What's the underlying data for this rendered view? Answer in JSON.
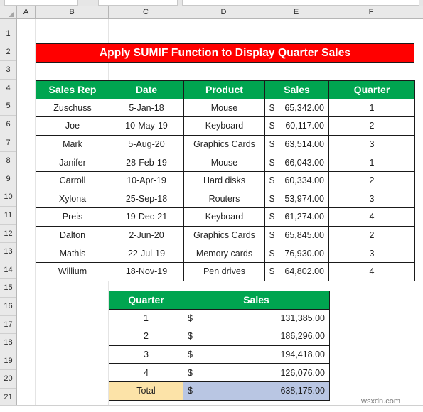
{
  "app": {
    "type": "spreadsheet",
    "watermark": "wsxdn.com"
  },
  "grid": {
    "column_headers": [
      "A",
      "B",
      "C",
      "D",
      "E",
      "F"
    ],
    "row_headers": [
      "1",
      "2",
      "3",
      "4",
      "5",
      "6",
      "7",
      "8",
      "9",
      "10",
      "11",
      "12",
      "13",
      "14",
      "15",
      "16",
      "17",
      "18",
      "19",
      "20",
      "21"
    ],
    "select_all_icon": "select-all-triangle-icon"
  },
  "title_banner": {
    "text": "Apply SUMIF Function to Display Quarter Sales",
    "background": "#FF0000",
    "text_color": "#FFFFFF",
    "range": "B2:F2"
  },
  "sales_table": {
    "range": "B4:F14",
    "header_background": "#00A550",
    "headers": [
      "Sales Rep",
      "Date",
      "Product",
      "Sales",
      "Quarter"
    ],
    "rows": [
      {
        "sales_rep": "Zuschuss",
        "date": "5-Jan-18",
        "product": "Mouse",
        "currency": "$",
        "sales": "65,342.00",
        "quarter": "1"
      },
      {
        "sales_rep": "Joe",
        "date": "10-May-19",
        "product": "Keyboard",
        "currency": "$",
        "sales": "60,117.00",
        "quarter": "2"
      },
      {
        "sales_rep": "Mark",
        "date": "5-Aug-20",
        "product": "Graphics Cards",
        "currency": "$",
        "sales": "63,514.00",
        "quarter": "3"
      },
      {
        "sales_rep": "Janifer",
        "date": "28-Feb-19",
        "product": "Mouse",
        "currency": "$",
        "sales": "66,043.00",
        "quarter": "1"
      },
      {
        "sales_rep": "Carroll",
        "date": "10-Apr-19",
        "product": "Hard disks",
        "currency": "$",
        "sales": "60,334.00",
        "quarter": "2"
      },
      {
        "sales_rep": "Xylona",
        "date": "25-Sep-18",
        "product": "Routers",
        "currency": "$",
        "sales": "53,974.00",
        "quarter": "3"
      },
      {
        "sales_rep": "Preis",
        "date": "19-Dec-21",
        "product": "Keyboard",
        "currency": "$",
        "sales": "61,274.00",
        "quarter": "4"
      },
      {
        "sales_rep": "Dalton",
        "date": "2-Jun-20",
        "product": "Graphics Cards",
        "currency": "$",
        "sales": "65,845.00",
        "quarter": "2"
      },
      {
        "sales_rep": "Mathis",
        "date": "22-Jul-19",
        "product": "Memory cards",
        "currency": "$",
        "sales": "76,930.00",
        "quarter": "3"
      },
      {
        "sales_rep": "Willium",
        "date": "18-Nov-19",
        "product": "Pen drives",
        "currency": "$",
        "sales": "64,802.00",
        "quarter": "4"
      }
    ]
  },
  "summary_table": {
    "range": "C16:E21",
    "header_background": "#00A550",
    "headers": [
      "Quarter",
      "Sales"
    ],
    "rows": [
      {
        "quarter": "1",
        "currency": "$",
        "sales": "131,385.00"
      },
      {
        "quarter": "2",
        "currency": "$",
        "sales": "186,296.00"
      },
      {
        "quarter": "3",
        "currency": "$",
        "sales": "194,418.00"
      },
      {
        "quarter": "4",
        "currency": "$",
        "sales": "126,076.00"
      }
    ],
    "total": {
      "label": "Total",
      "currency": "$",
      "sales": "638,175.00",
      "label_background": "#FCE3A8",
      "value_background": "#B9C6E3"
    }
  }
}
